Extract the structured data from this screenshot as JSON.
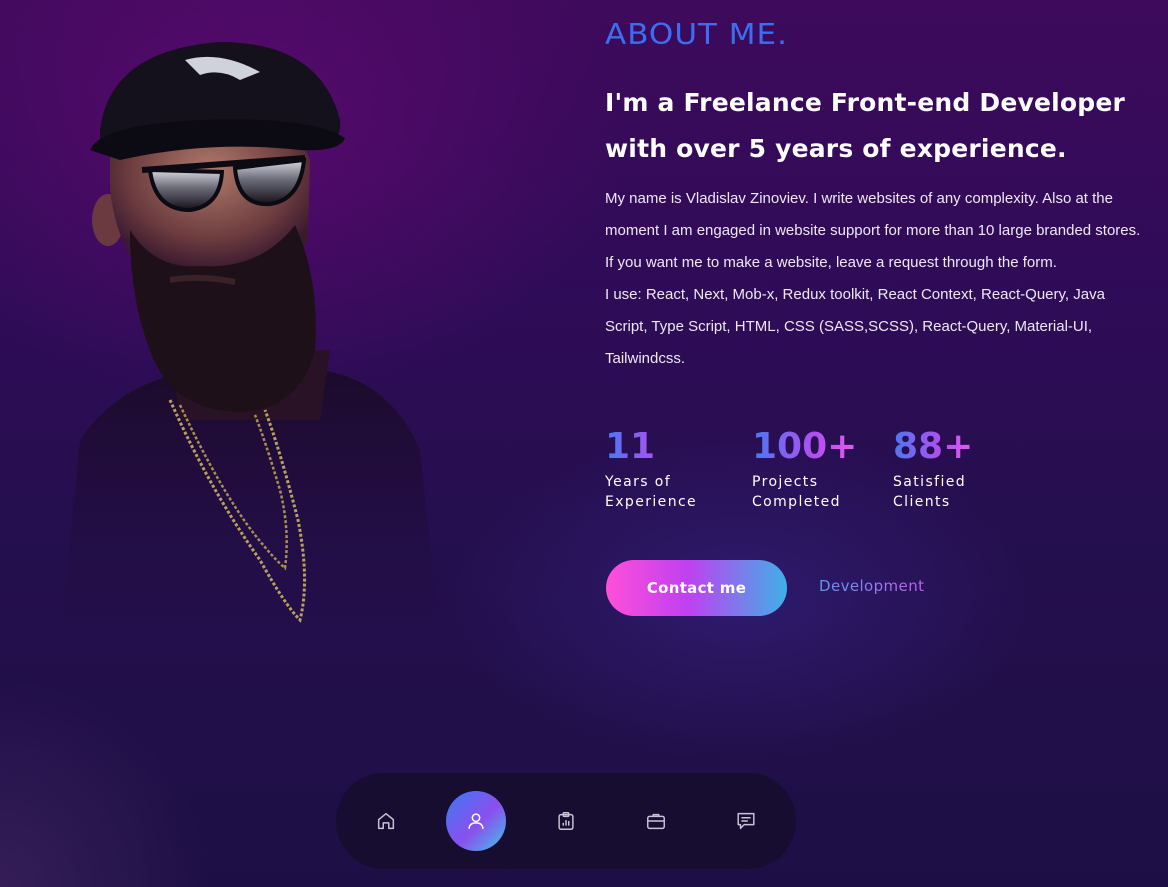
{
  "about": {
    "title": "ABOUT ME.",
    "headline": "I'm a Freelance Front-end Developer with over 5 years of experience.",
    "bio_paragraph_1": "My name is Vladislav Zinoviev. I write websites of any complexity. Also at the moment I am engaged in website support for more than 10 large branded stores. If you want me to make a website, leave a request through the form.",
    "bio_paragraph_2": "I use: React, Next, Mob-x, Redux toolkit, React Context, React-Query, Java Script, Type Script, HTML, CSS (SASS,SCSS), React-Query, Material-UI, Tailwindcss."
  },
  "stats": [
    {
      "value": "11",
      "label_line_1": "Years of",
      "label_line_2": "Experience"
    },
    {
      "value": "100+",
      "label_line_1": "Projects",
      "label_line_2": "Completed"
    },
    {
      "value": "88+",
      "label_line_1": "Satisfied",
      "label_line_2": "Clients"
    }
  ],
  "actions": {
    "contact_label": "Contact me",
    "development_label": "Development"
  },
  "dock": {
    "items": [
      {
        "icon": "home-icon",
        "active": false
      },
      {
        "icon": "user-icon",
        "active": true
      },
      {
        "icon": "clipboard-chart-icon",
        "active": false
      },
      {
        "icon": "briefcase-icon",
        "active": false
      },
      {
        "icon": "message-icon",
        "active": false
      }
    ]
  },
  "colors": {
    "accent_blue": "#3b6ff0",
    "accent_pink": "#ff4fd8",
    "accent_purple": "#b14ff0",
    "background": "#250f4e"
  }
}
